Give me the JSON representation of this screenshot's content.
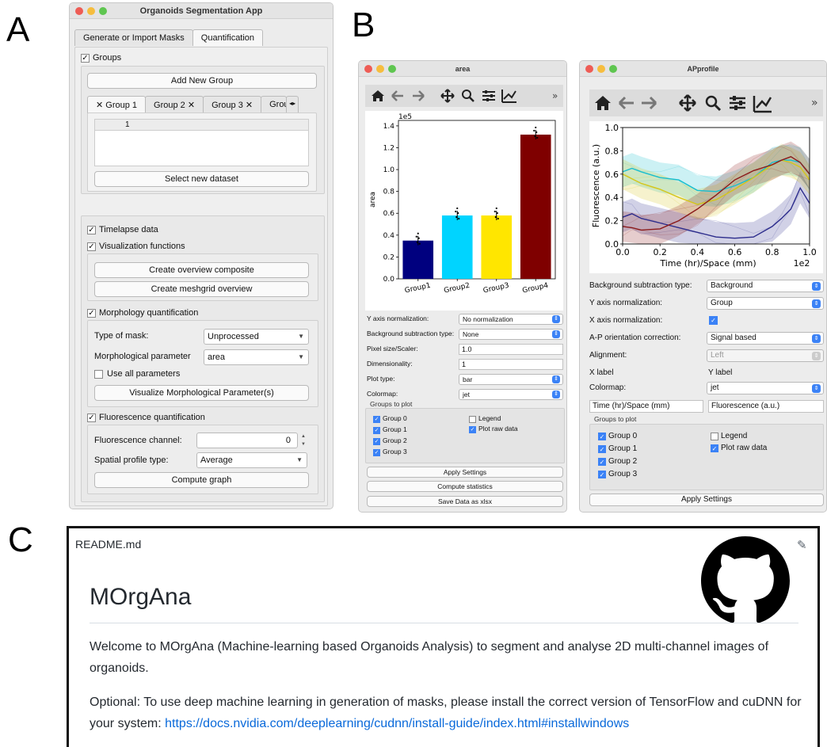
{
  "panel_letters": {
    "a": "A",
    "b": "B",
    "c": "C"
  },
  "app": {
    "title": "Organoids Segmentation App",
    "tabs": [
      "Generate or Import Masks",
      "Quantification"
    ],
    "groups_label": "Groups",
    "add_group": "Add New Group",
    "group_tabs": [
      "Group 1",
      "Group 2",
      "Group 3",
      "Grou"
    ],
    "table_header": "1",
    "select_dataset": "Select new dataset",
    "timelapse": "Timelapse data",
    "vis_functions": "Visualization functions",
    "overview_composite": "Create overview composite",
    "meshgrid_overview": "Create meshgrid overview",
    "morphology": "Morphology quantification",
    "type_of_mask_label": "Type of mask:",
    "type_of_mask_value": "Unprocessed",
    "morph_param_label": "Morphological parameter",
    "morph_param_value": "area",
    "use_all": "Use all parameters",
    "visualize_morph": "Visualize Morphological Parameter(s)",
    "fluorescence": "Fluorescence quantification",
    "fluo_channel_label": "Fluorescence channel:",
    "fluo_channel_value": "0",
    "spatial_label": "Spatial profile type:",
    "spatial_value": "Average",
    "compute_graph": "Compute graph"
  },
  "area_window": {
    "title": "area",
    "rows": [
      {
        "label": "Y axis normalization:",
        "value": "No normalization"
      },
      {
        "label": "Background subtraction type:",
        "value": "None"
      },
      {
        "label": "Pixel size/Scaler:",
        "value": "1.0"
      },
      {
        "label": "Dimensionality:",
        "value": "1"
      },
      {
        "label": "Plot type:",
        "value": "bar"
      },
      {
        "label": "Colormap:",
        "value": "jet"
      }
    ],
    "groups_to_plot": "Groups to plot",
    "groups": [
      "Group 0",
      "Group 1",
      "Group 2",
      "Group 3"
    ],
    "legend": "Legend",
    "plot_raw": "Plot raw data",
    "apply": "Apply Settings",
    "compute_stats": "Compute statistics",
    "save_xlsx": "Save Data as xlsx"
  },
  "ap_window": {
    "title": "APprofile",
    "rows": [
      {
        "label": "Background subtraction type:",
        "value": "Background"
      },
      {
        "label": "Y axis normalization:",
        "value": "Group"
      },
      {
        "label": "X axis normalization:",
        "value": ""
      },
      {
        "label": "A-P orientation correction:",
        "value": "Signal based"
      },
      {
        "label": "Alignment:",
        "value": "Left"
      },
      {
        "label": "X label",
        "value": "Y label"
      },
      {
        "label": "Colormap:",
        "value": "jet"
      }
    ],
    "xlabel_value": "Time (hr)/Space (mm)",
    "ylabel_value": "Fluorescence (a.u.)",
    "groups_to_plot": "Groups to plot",
    "groups": [
      "Group 0",
      "Group 1",
      "Group 2",
      "Group 3"
    ],
    "legend": "Legend",
    "plot_raw": "Plot raw data",
    "apply": "Apply Settings"
  },
  "readme": {
    "filename": "README.md",
    "heading": "MOrgAna",
    "para1": "Welcome to MOrgAna (Machine-learning based Organoids Analysis) to segment and analyse 2D multi-channel images of organoids.",
    "para2": "Optional: To use deep machine learning in generation of masks, please install the correct version of TensorFlow and cuDNN for your system:",
    "link": "https://docs.nvidia.com/deeplearning/cudnn/install-guide/index.html#installwindows"
  },
  "chart_data": [
    {
      "type": "bar",
      "title": "",
      "offset_label": "1e5",
      "ylabel": "area",
      "xlabel": "",
      "categories": [
        "Group1",
        "Group2",
        "Group3",
        "Group4"
      ],
      "values": [
        0.35,
        0.58,
        0.58,
        1.32
      ],
      "colors": [
        "#00007f",
        "#00d4ff",
        "#ffe600",
        "#7f0000"
      ],
      "yticks": [
        "0.0",
        "0.2",
        "0.4",
        "0.6",
        "0.8",
        "1.0",
        "1.2",
        "1.4"
      ],
      "ylim": [
        0,
        1.45
      ]
    },
    {
      "type": "line",
      "title": "",
      "xlabel": "Time (hr)/Space (mm)",
      "ylabel": "Fluorescence (a.u.)",
      "x_offset_label": "1e2",
      "xticks": [
        "0.0",
        "0.2",
        "0.4",
        "0.6",
        "0.8",
        "1.0"
      ],
      "yticks": [
        "0.0",
        "0.2",
        "0.4",
        "0.6",
        "0.8",
        "1.0"
      ],
      "xlim": [
        0,
        1.0
      ],
      "ylim": [
        0,
        1.0
      ],
      "x": [
        0.0,
        0.05,
        0.1,
        0.2,
        0.3,
        0.4,
        0.5,
        0.6,
        0.7,
        0.8,
        0.85,
        0.9,
        0.95,
        1.0
      ],
      "series": [
        {
          "color": "#2c2c8c",
          "values": [
            0.23,
            0.26,
            0.22,
            0.18,
            0.14,
            0.1,
            0.06,
            0.05,
            0.06,
            0.15,
            0.22,
            0.3,
            0.48,
            0.35
          ]
        },
        {
          "color": "#17becf",
          "values": [
            0.62,
            0.65,
            0.62,
            0.57,
            0.55,
            0.46,
            0.45,
            0.5,
            0.57,
            0.7,
            0.72,
            0.72,
            0.7,
            0.6
          ]
        },
        {
          "color": "#d4c61a",
          "values": [
            0.6,
            0.56,
            0.52,
            0.47,
            0.4,
            0.34,
            0.38,
            0.47,
            0.57,
            0.68,
            0.72,
            0.7,
            0.66,
            0.55
          ]
        },
        {
          "color": "#8b1a1a",
          "values": [
            0.15,
            0.14,
            0.12,
            0.13,
            0.2,
            0.3,
            0.42,
            0.55,
            0.63,
            0.68,
            0.72,
            0.75,
            0.7,
            0.6
          ]
        }
      ]
    }
  ]
}
